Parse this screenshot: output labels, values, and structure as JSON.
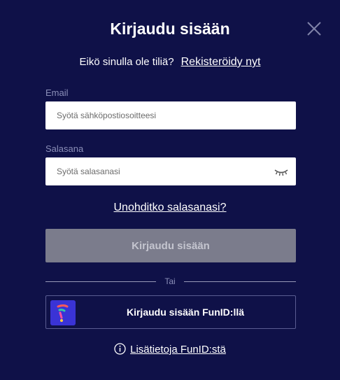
{
  "dialog": {
    "title": "Kirjaudu sisään",
    "close_icon": "close-icon"
  },
  "signup": {
    "question": "Eikö sinulla ole tiliä?",
    "link": "Rekisteröidy nyt"
  },
  "email": {
    "label": "Email",
    "placeholder": "Syötä sähköpostiosoitteesi",
    "value": ""
  },
  "password": {
    "label": "Salasana",
    "placeholder": "Syötä salasanasi",
    "value": "",
    "toggle_icon": "eye-closed-icon"
  },
  "forgot_link": "Unohditko salasanasi?",
  "login_button": "Kirjaudu sisään",
  "divider": "Tai",
  "funid": {
    "button_label": "Kirjaudu sisään FunID:llä",
    "logo_icon": "funid-logo-icon"
  },
  "info": {
    "icon": "info-icon",
    "link": "Lisätietoja FunID:stä"
  },
  "colors": {
    "background": "#0f1148",
    "disabled_button": "#7b7c8c",
    "label": "#8b8fb8",
    "funid_brand": "#3a33d6"
  }
}
